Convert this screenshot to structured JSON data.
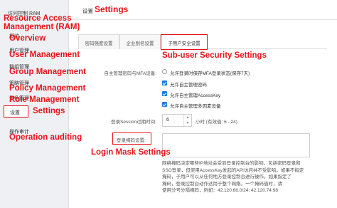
{
  "sidebar": {
    "title": "访问控制 RAM",
    "items": [
      {
        "label": "概览"
      },
      {
        "label": "用户管理"
      },
      {
        "label": "群组管理"
      },
      {
        "label": "策略管理"
      },
      {
        "label": "角色管理"
      },
      {
        "label": "设置"
      },
      {
        "label": "操作审计"
      }
    ]
  },
  "annotations": {
    "ram": "Resource Access Management (RAM)",
    "overview": "Overview",
    "user_management": "User Management",
    "group_management": "Group Management",
    "policy_management": "Policy Management",
    "role_management": "Role Management",
    "settings": "Settings",
    "operation_auditing": "Operation auditing",
    "page_settings": "Settings",
    "subuser_security": "Sub-user Security Settings",
    "login_mask": "Login Mask Settings"
  },
  "header": {
    "title": "设置"
  },
  "tabs": [
    {
      "label": "密码强度设置"
    },
    {
      "label": "企业别名设置"
    },
    {
      "label": "子用户安全设置"
    }
  ],
  "form": {
    "password_mfa_label": "自主管理密码与MFA设备:",
    "options": [
      {
        "label": "允许登录时保存MFA登录状态(保存7天)",
        "checked": false
      },
      {
        "label": "允许自主管理密码",
        "checked": true
      },
      {
        "label": "允许自主管理AccessKey",
        "checked": true
      },
      {
        "label": "允许自主管理多因素设备",
        "checked": true
      }
    ],
    "session_label": "登录Session过期时间:",
    "session_value": "6",
    "session_hint": "小时 (有效值: 6 - 24)",
    "mask_label": "登录掩码设置:",
    "mask_value": "",
    "help_text": "网络掩码决定哪些IP地址会受到登录控制台的影响，包括密码登录和SSO登录，但使用AccessKey发起的API访问并不受影响。如果不指定掩码，子用户可以从任何地方登录控制台进行操作。如果不指定仅可以从指定网段登录。一个掩码值，当用户登录设置时必须用分号分隔，例如：42.120.66.0/24; 42.120.74.98",
    "help_lines": [
      "网络掩码决定哪些IP地址会受到登录控制台的影响，包括密码登录和",
      "SSO登录，但使用AccessKey发起的API访问并不受影响。如果不指定",
      "掩码，子用户可以从任何地方登录控制台进行操作。如果指定了",
      "掩码，登录控制台动作适用于整个网络。一个掩码值时，请",
      "使用分号分隔掩码，例如：42.120.66.0/24; 42.120.74.98"
    ]
  },
  "colors": {
    "annotation": "#e7141a",
    "checkbox": "#1f7ae0",
    "sidebar_bg": "#eef0f3"
  }
}
